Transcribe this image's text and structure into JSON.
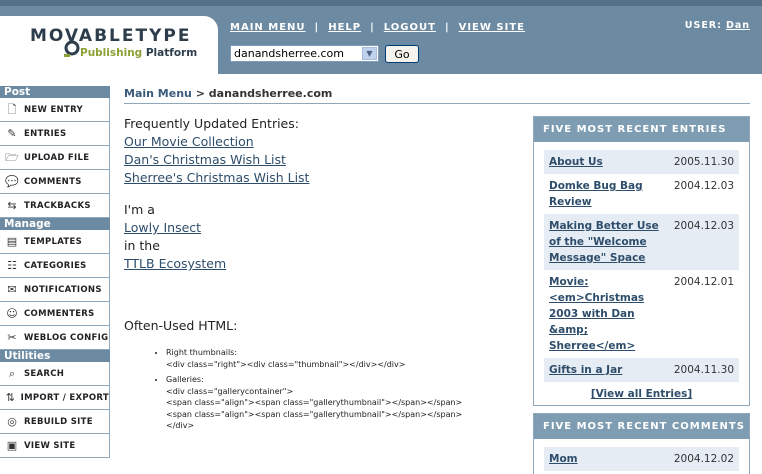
{
  "app": {
    "logo_text": "MOVABLETYPE",
    "logo_tagline_part1": "Publishing",
    "logo_tagline_part2": "Platform"
  },
  "topnav": {
    "items": [
      {
        "label": "MAIN MENU"
      },
      {
        "label": "HELP"
      },
      {
        "label": "LOGOUT"
      },
      {
        "label": "VIEW SITE"
      }
    ],
    "separator": "|",
    "user_label": "USER:",
    "user_name": "Dan"
  },
  "blog_selector": {
    "selected": "danandsherree.com",
    "go_label": "Go"
  },
  "sidebar": {
    "sections": [
      {
        "title": "Post",
        "items": [
          {
            "label": "NEW ENTRY",
            "icon": "new-entry-icon",
            "glyph": "🗋"
          },
          {
            "label": "ENTRIES",
            "icon": "entries-icon",
            "glyph": "✎"
          },
          {
            "label": "UPLOAD FILE",
            "icon": "upload-folder-icon",
            "glyph": "🗁"
          },
          {
            "label": "COMMENTS",
            "icon": "comment-bubble-icon",
            "glyph": "💬"
          },
          {
            "label": "TRACKBACKS",
            "icon": "trackback-icon",
            "glyph": "⇆"
          }
        ]
      },
      {
        "title": "Manage",
        "items": [
          {
            "label": "TEMPLATES",
            "icon": "templates-icon",
            "glyph": "▤"
          },
          {
            "label": "CATEGORIES",
            "icon": "categories-icon",
            "glyph": "☷"
          },
          {
            "label": "NOTIFICATIONS",
            "icon": "envelope-icon",
            "glyph": "✉"
          },
          {
            "label": "COMMENTERS",
            "icon": "commenters-icon",
            "glyph": "☺"
          },
          {
            "label": "WEBLOG CONFIG",
            "icon": "tools-icon",
            "glyph": "✂"
          }
        ]
      },
      {
        "title": "Utilities",
        "items": [
          {
            "label": "SEARCH",
            "icon": "search-icon",
            "glyph": "⌕"
          },
          {
            "label": "IMPORT / EXPORT",
            "icon": "import-export-icon",
            "glyph": "⇅"
          },
          {
            "label": "REBUILD SITE",
            "icon": "rebuild-icon",
            "glyph": "◎"
          },
          {
            "label": "VIEW SITE",
            "icon": "view-site-icon",
            "glyph": "▣"
          }
        ]
      }
    ]
  },
  "breadcrumb": {
    "root": "Main Menu",
    "sep": ">",
    "current": "danandsherree.com"
  },
  "main": {
    "freq_title": "Frequently Updated Entries:",
    "freq_links": [
      "Our Movie Collection",
      "Dan's Christmas Wish List",
      "Sherree's Christmas Wish List"
    ],
    "im_a": "I'm a",
    "insect_link": "Lowly Insect",
    "in_the": "in the",
    "ecosystem_link": "TTLB Ecosystem",
    "html_title": "Often-Used HTML:",
    "html_items": [
      {
        "label": "Right thumbnails:",
        "lines": [
          "<div class=\"right\"><div class=\"thumbnail\"></div></div>"
        ]
      },
      {
        "label": "Galleries:",
        "lines": [
          "<div class=\"gallerycontainer\">",
          "<span class=\"align\"><span class=\"gallerythumbnail\"></span></span>",
          "<span class=\"align\"><span class=\"gallerythumbnail\"></span></span>",
          "</div>"
        ]
      }
    ]
  },
  "recent_entries": {
    "title": "FIVE MOST RECENT ENTRIES",
    "rows": [
      {
        "title": "About Us",
        "date": "2005.11.30"
      },
      {
        "title": "Domke Bug Bag Review",
        "date": "2004.12.03"
      },
      {
        "title": "Making Better Use of the \"Welcome Message\" Space",
        "date": "2004.12.03"
      },
      {
        "title": "Movie: <em>Christmas 2003 with Dan &amp; Sherree</em>",
        "date": "2004.12.01"
      },
      {
        "title": "Gifts in a Jar",
        "date": "2004.11.30"
      }
    ],
    "view_all": "[View all Entries]"
  },
  "recent_comments": {
    "title": "FIVE MOST RECENT COMMENTS",
    "rows": [
      {
        "title": "Mom",
        "date": "2004.12.02"
      }
    ]
  },
  "colors": {
    "header_bg": "#6c8aa1",
    "panel_head": "#7f9db2",
    "link": "#2e4d6b",
    "row_alt": "#e6ecf3",
    "logo_accent": "#8ba035"
  }
}
